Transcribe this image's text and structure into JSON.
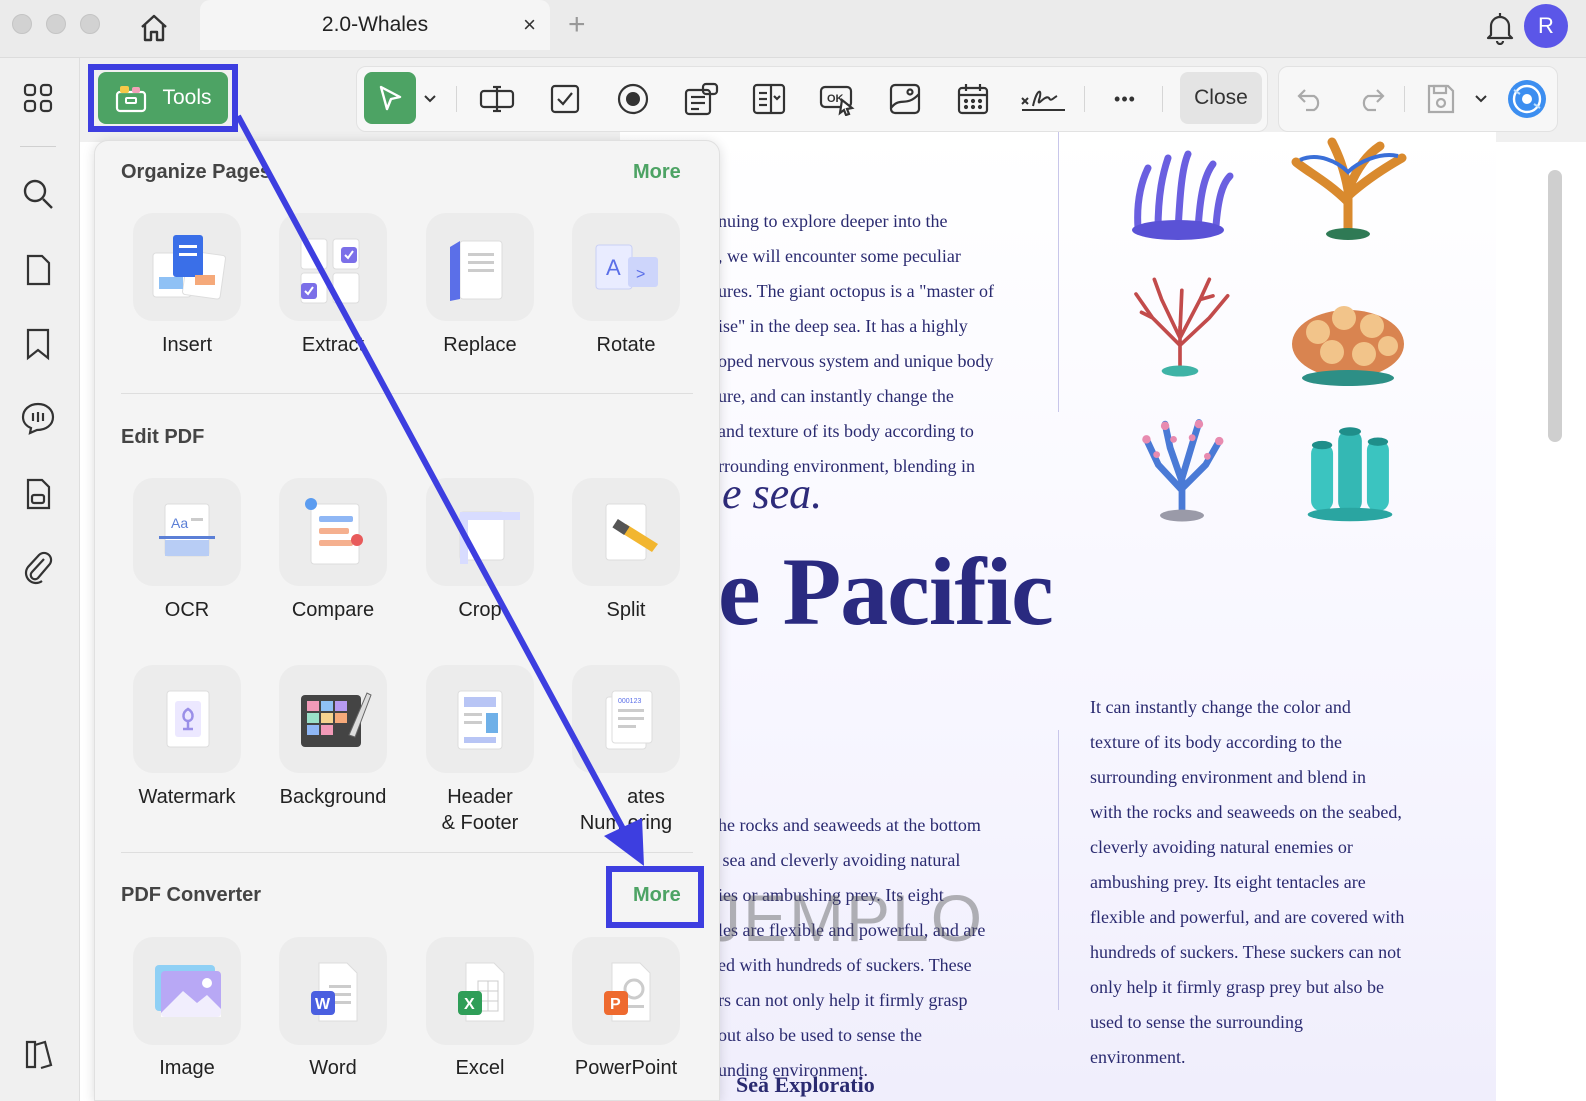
{
  "window": {
    "tab_title": "2.0-Whales",
    "tab_close": "×",
    "tab_add": "+",
    "avatar_initial": "R"
  },
  "toolbar": {
    "tools_label": "Tools",
    "close_label": "Close",
    "more_glyph": "•••",
    "icons": [
      "select-cursor-icon",
      "text-field-icon",
      "checkbox-icon",
      "radio-button-icon",
      "list-box-icon",
      "dropdown-field-icon",
      "ok-button-icon",
      "image-field-icon",
      "date-field-icon",
      "signature-icon",
      "undo-icon",
      "redo-icon",
      "save-icon",
      "ai-assistant-icon"
    ]
  },
  "left_rail": {
    "icons": [
      "grid-icon",
      "search-icon",
      "page-icon",
      "bookmark-icon",
      "comment-icon",
      "form-icon",
      "attachment-icon",
      "sidebar-toggle-icon"
    ]
  },
  "tools_panel": {
    "sections": [
      {
        "title": "Organize Pages",
        "more": "More",
        "items": [
          {
            "label": "Insert",
            "icon": "insert-pages-icon"
          },
          {
            "label": "Extract",
            "icon": "extract-pages-icon"
          },
          {
            "label": "Replace",
            "icon": "replace-pages-icon"
          },
          {
            "label": "Rotate",
            "icon": "rotate-pages-icon"
          }
        ]
      },
      {
        "title": "Edit PDF",
        "items": [
          {
            "label": "OCR",
            "icon": "ocr-icon"
          },
          {
            "label": "Compare",
            "icon": "compare-icon"
          },
          {
            "label": "Crop",
            "icon": "crop-icon"
          },
          {
            "label": "Split",
            "icon": "split-icon"
          },
          {
            "label": "Watermark",
            "icon": "watermark-icon"
          },
          {
            "label": "Background",
            "icon": "background-icon"
          },
          {
            "label": "Header\n& Footer",
            "label_line1": "Header",
            "label_line2": "& Footer",
            "icon": "header-footer-icon"
          },
          {
            "label": "Bates Numbering",
            "label_line1": "ates",
            "label_line2": "Num ering",
            "icon": "bates-numbering-icon"
          }
        ]
      },
      {
        "title": "PDF Converter",
        "more": "More",
        "items": [
          {
            "label": "Image",
            "icon": "image-convert-icon"
          },
          {
            "label": "Word",
            "icon": "word-convert-icon"
          },
          {
            "label": "Excel",
            "icon": "excel-convert-icon"
          },
          {
            "label": "PowerPoint",
            "icon": "powerpoint-convert-icon"
          }
        ]
      }
    ]
  },
  "document": {
    "para1": [
      "nuing to explore deeper into the",
      ", we will encounter some peculiar",
      "ures. The giant octopus is a \"master of",
      "ise\" in the deep sea. It has a highly",
      "oped nervous system and unique body",
      "ure, and can instantly change the",
      "and texture of its body according to",
      "rrounding environment, blending in"
    ],
    "heading_sea": "e sea.",
    "heading_pacific": "e Pacific",
    "para2": [
      "he rocks and seaweeds at the bottom",
      " sea and cleverly avoiding natural",
      "ies or ambushing prey. Its eight",
      "les are flexible and powerful, and are",
      "ed with hundreds of suckers. These",
      "rs can not only help it firmly grasp",
      "out also be used to sense the",
      "unding environment."
    ],
    "para3": [
      "It can instantly change the color and",
      "texture of its body according to the",
      "surrounding environment and blend in",
      "with the rocks and seaweeds on the seabed,",
      "cleverly avoiding natural enemies or",
      "ambushing prey. Its eight tentacles are",
      "flexible and powerful, and are covered with",
      "hundreds of suckers. These suckers can not",
      "only help it firmly grasp prey but also be",
      "used to sense the surrounding",
      "environment."
    ],
    "watermark": "JEMPLO",
    "footer_heading": "Sea Exploratio"
  },
  "colors": {
    "accent_green": "#4da364",
    "highlight_blue": "#3d3ee0",
    "doc_text": "#2a2a70"
  }
}
